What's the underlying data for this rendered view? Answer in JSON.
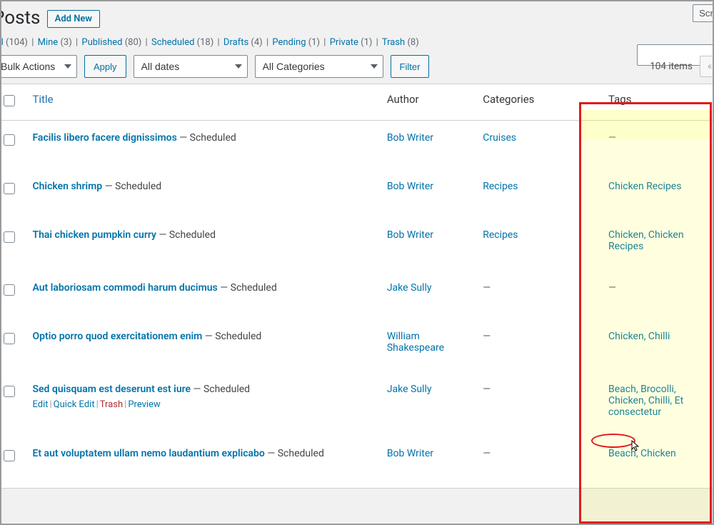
{
  "page": {
    "title": "Posts",
    "add_new": "Add New",
    "screen_btn": "Scr"
  },
  "filters": {
    "all_label": "All",
    "all_count": "(104)",
    "mine_label": "Mine",
    "mine_count": "(3)",
    "published_label": "Published",
    "published_count": "(80)",
    "scheduled_label": "Scheduled",
    "scheduled_count": "(18)",
    "drafts_label": "Drafts",
    "drafts_count": "(4)",
    "pending_label": "Pending",
    "pending_count": "(1)",
    "private_label": "Private",
    "private_count": "(1)",
    "trash_label": "Trash",
    "trash_count": "(8)"
  },
  "nav": {
    "bulk": "Bulk Actions",
    "apply": "Apply",
    "dates": "All dates",
    "cats": "All Categories",
    "filter": "Filter",
    "items": "104 items",
    "prev_glyph": "«"
  },
  "columns": {
    "title": "Title",
    "author": "Author",
    "categories": "Categories",
    "tags": "Tags"
  },
  "actions": {
    "edit": "Edit",
    "quick": "Quick Edit",
    "trash": "Trash",
    "preview": "Preview"
  },
  "rows": [
    {
      "title": "Facilis libero facere dignissimos",
      "status": "Scheduled",
      "author": "Bob Writer",
      "categories": "Cruises",
      "tags": "—",
      "show_actions": false
    },
    {
      "title": "Chicken shrimp",
      "status": "Scheduled",
      "author": "Bob Writer",
      "categories": "Recipes",
      "tags": "Chicken Recipes",
      "show_actions": false
    },
    {
      "title": "Thai chicken pumpkin curry",
      "status": "Scheduled",
      "author": "Bob Writer",
      "categories": "Recipes",
      "tags": "Chicken, Chicken Recipes",
      "show_actions": false
    },
    {
      "title": "Aut laboriosam commodi harum ducimus",
      "status": "Scheduled",
      "author": "Jake Sully",
      "categories": "—",
      "tags": "—",
      "show_actions": false
    },
    {
      "title": "Optio porro quod exercitationem enim",
      "status": "Scheduled",
      "author": "William Shakespeare",
      "categories": "—",
      "tags": "Chicken, Chilli",
      "show_actions": false
    },
    {
      "title": "Sed quisquam est deserunt est iure",
      "status": "Scheduled",
      "author": "Jake Sully",
      "categories": "—",
      "tags": "Beach, Brocolli, Chicken, Chilli, Et consectetur",
      "show_actions": true
    },
    {
      "title": "Et aut voluptatem ullam nemo laudantium explicabo",
      "status": "Scheduled",
      "author": "Bob Writer",
      "categories": "—",
      "tags": "Beach, Chicken",
      "show_actions": false
    }
  ]
}
